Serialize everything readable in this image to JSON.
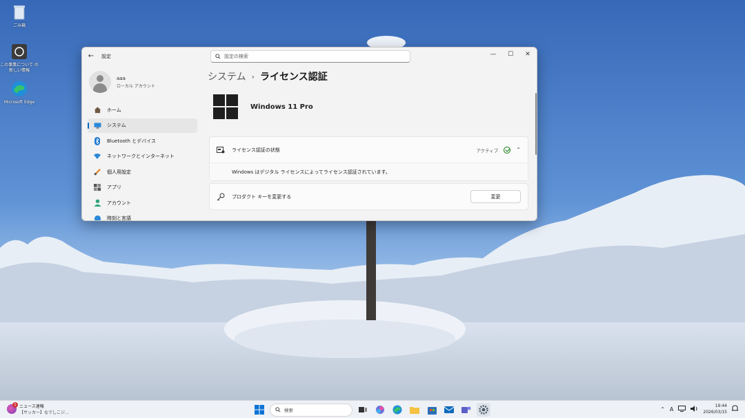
{
  "desktop": {
    "icons": [
      {
        "label": "ごみ箱",
        "icon": "recycle-bin-icon"
      },
      {
        "label": "この事業について の新しい情報",
        "icon": "help-icon"
      },
      {
        "label": "Microsoft Edge",
        "icon": "edge-icon"
      }
    ]
  },
  "window": {
    "app_title": "設定",
    "search_placeholder": "設定の検索",
    "controls": {
      "minimize": "—",
      "maximize": "☐",
      "close": "✕"
    },
    "profile": {
      "name": "aaa",
      "account_type": "ローカル アカウント"
    },
    "nav": [
      {
        "label": "ホーム",
        "icon": "home-icon"
      },
      {
        "label": "システム",
        "icon": "system-icon"
      },
      {
        "label": "Bluetooth とデバイス",
        "icon": "bluetooth-icon"
      },
      {
        "label": "ネットワークとインターネット",
        "icon": "network-icon"
      },
      {
        "label": "個人用設定",
        "icon": "personalization-icon"
      },
      {
        "label": "アプリ",
        "icon": "apps-icon"
      },
      {
        "label": "アカウント",
        "icon": "account-icon"
      },
      {
        "label": "時刻と言語",
        "icon": "time-icon"
      }
    ],
    "active_nav": "システム",
    "breadcrumb": {
      "parent": "システム",
      "separator": "›",
      "current": "ライセンス認証"
    },
    "product": {
      "name": "Windows 11 Pro"
    },
    "activation": {
      "label": "ライセンス認証の状態",
      "status": "アクティブ",
      "detail": "Windows はデジタル ライセンスによってライセンス認証されています。"
    },
    "product_key": {
      "label": "プロダクト キーを変更する",
      "button": "変更"
    }
  },
  "taskbar": {
    "news_title": "ニュース速報",
    "news_sub": "【サッカー】なでしこジ...",
    "news_badge": "1",
    "search_placeholder": "検索",
    "clock_time": "19:44",
    "clock_date": "2026/03/15",
    "input_indicator": "A"
  },
  "colors": {
    "accent": "#0067c0",
    "status_ok": "#0f7b0f",
    "sky": "#3e72bf"
  }
}
